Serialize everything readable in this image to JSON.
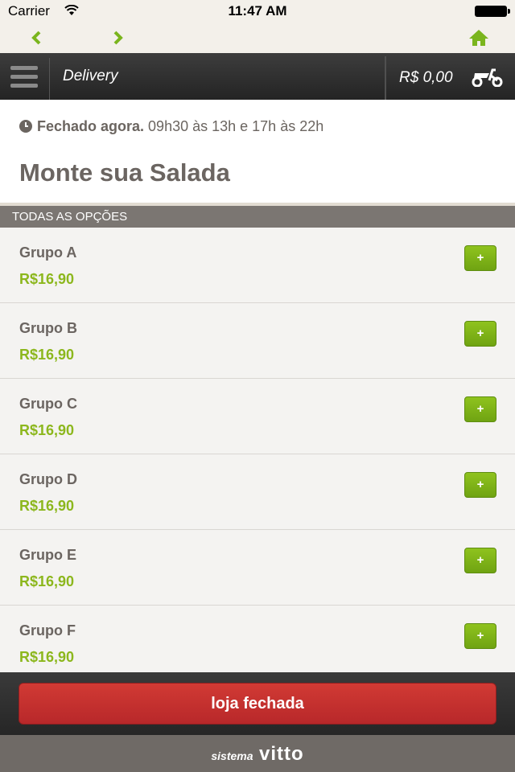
{
  "status_bar": {
    "carrier": "Carrier",
    "time": "11:47 AM"
  },
  "header": {
    "title": "Delivery",
    "cart_total": "R$ 0,00"
  },
  "store": {
    "status": "Fechado agora.",
    "hours": "09h30 às 13h e 17h às 22h",
    "title": "Monte sua Salada"
  },
  "section": {
    "title": "TODAS AS OPÇÕES"
  },
  "items": [
    {
      "name": "Grupo A",
      "price": "R$16,90",
      "button": "+"
    },
    {
      "name": "Grupo B",
      "price": "R$16,90",
      "button": "+"
    },
    {
      "name": "Grupo C",
      "price": "R$16,90",
      "button": "+"
    },
    {
      "name": "Grupo D",
      "price": "R$16,90",
      "button": "+"
    },
    {
      "name": "Grupo E",
      "price": "R$16,90",
      "button": "+"
    },
    {
      "name": "Grupo F",
      "price": "R$16,90",
      "button": "+"
    }
  ],
  "footer": {
    "button": "loja fechada"
  },
  "brand": {
    "small": "sistema",
    "name": "vitto"
  },
  "colors": {
    "accent_green": "#8cb71d",
    "closed_red": "#c53030",
    "header_dark": "#2e2e2e"
  },
  "icons": [
    "wifi-icon",
    "battery-icon",
    "back-arrow-icon",
    "forward-arrow-icon",
    "home-icon",
    "menu-icon",
    "scooter-icon",
    "clock-icon"
  ]
}
